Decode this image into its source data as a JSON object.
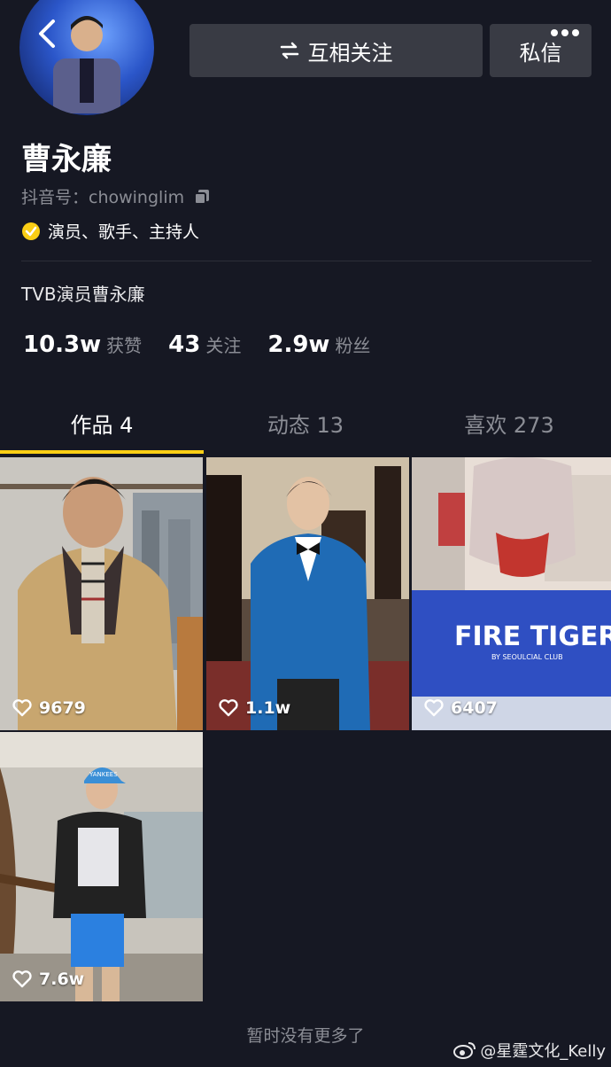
{
  "header": {
    "follow_button": "互相关注",
    "follow_icon": "swap-arrows-icon",
    "message_button": "私信"
  },
  "profile": {
    "name": "曹永廉",
    "douyin_id": "抖音号：chowinglim",
    "roles": "演员、歌手、主持人",
    "bio": "TVB演员曹永廉"
  },
  "stats": [
    {
      "value": "10.3w",
      "label": "获赞"
    },
    {
      "value": "43",
      "label": "关注"
    },
    {
      "value": "2.9w",
      "label": "粉丝"
    }
  ],
  "tabs": [
    {
      "label": "作品 4",
      "active": true
    },
    {
      "label": "动态 13",
      "active": false
    },
    {
      "label": "喜欢 273",
      "active": false
    }
  ],
  "videos": [
    {
      "likes": "9679"
    },
    {
      "likes": "1.1w"
    },
    {
      "likes": "6407",
      "sign_text": "FIRE TIGER",
      "sign_subtext": "BY SEOULCIAL CLUB"
    },
    {
      "likes": "7.6w",
      "cap_text": "YANKEES"
    }
  ],
  "footer": {
    "no_more": "暂时没有更多了",
    "watermark": "@星霆文化_Kelly"
  },
  "colors": {
    "background": "#161823",
    "accent_yellow": "#face15",
    "button_bg": "#393b44",
    "muted_text": "#8b8d95"
  }
}
